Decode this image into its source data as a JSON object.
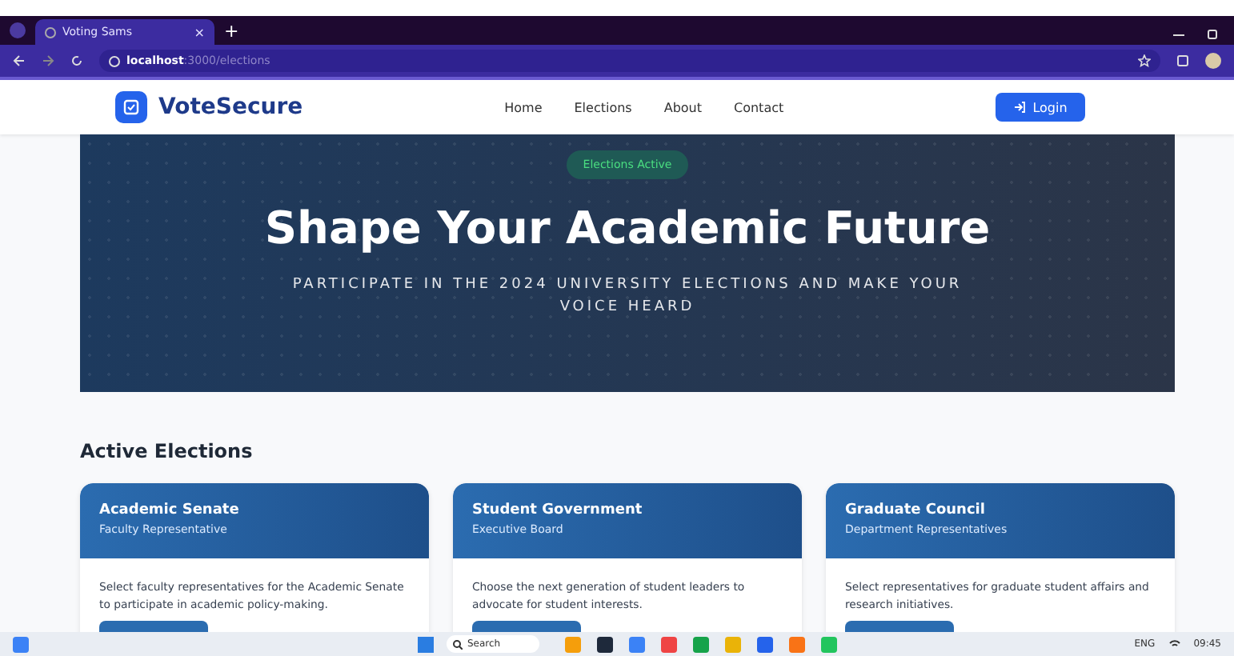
{
  "browser": {
    "tab_title": "Voting Sams",
    "tab_close": "×",
    "new_tab": "+",
    "address_host": "localhost",
    "address_path": ":3000/elections"
  },
  "navbar": {
    "brand": "VoteSecure",
    "links": [
      "Home",
      "Elections",
      "About",
      "Contact"
    ],
    "login": "Login"
  },
  "hero": {
    "badge": "Elections Active",
    "title": "Shape Your Academic Future",
    "subtitle": "PARTICIPATE IN THE 2024 UNIVERSITY ELECTIONS AND MAKE YOUR VOICE HEARD"
  },
  "section_title": "Active Elections",
  "elections": [
    {
      "title": "Academic Senate",
      "subtitle": "Faculty Representative",
      "description": "Select faculty representatives for the Academic Senate to participate in academic policy-making."
    },
    {
      "title": "Student Government",
      "subtitle": "Executive Board",
      "description": "Choose the next generation of student leaders to advocate for student interests."
    },
    {
      "title": "Graduate Council",
      "subtitle": "Department Representatives",
      "description": "Select representatives for graduate student affairs and research initiatives."
    }
  ],
  "taskbar": {
    "search": "Search",
    "language": "ENG",
    "time": "09:45"
  }
}
